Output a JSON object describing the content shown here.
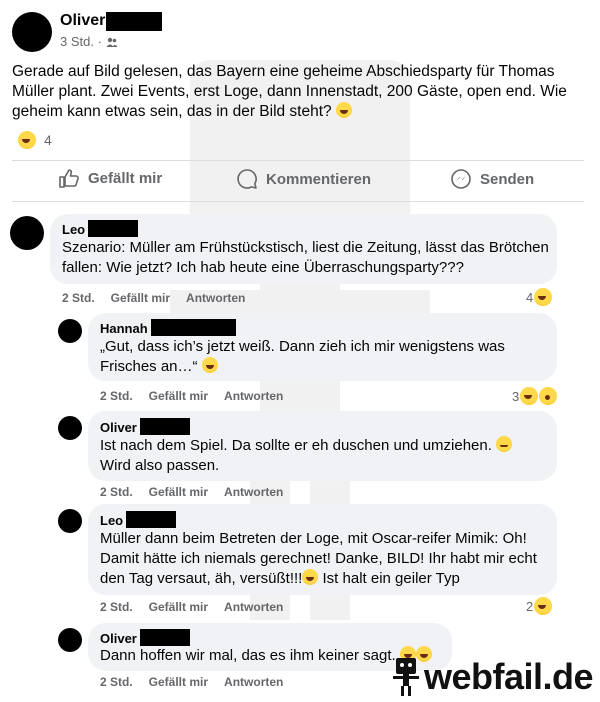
{
  "post": {
    "author": "Oliver",
    "time": "3 Std. ·",
    "audience_icon": "friends-icon",
    "text": "Gerade auf Bild gelesen, das Bayern eine geheime Abschiedsparty für Thomas Müller plant. Zwei Events, erst Loge, dann Innenstadt, 200 Gäste, open end. Wie geheim kann etwas sein, das in der Bild steht?",
    "reaction_count": "4"
  },
  "actions": {
    "like": "Gefällt mir",
    "comment": "Kommentieren",
    "share": "Senden"
  },
  "comments": [
    {
      "name": "Leo",
      "text": "Szenario: Müller am Frühstückstisch, liest die Zeitung, lässt das Brötchen fallen: Wie jetzt? Ich hab heute eine Überraschungsparty???",
      "time": "2 Std.",
      "like": "Gefällt mir",
      "reply": "Antworten",
      "reactions": "4"
    },
    {
      "name": "Hannah",
      "text": "„Gut, dass ich’s jetzt weiß. Dann zieh ich mir wenigstens was Frisches an…“",
      "time": "2 Std.",
      "like": "Gefällt mir",
      "reply": "Antworten",
      "reactions": "3"
    },
    {
      "name": "Oliver",
      "text": "Ist nach dem Spiel. Da sollte er eh duschen und umziehen.",
      "text2": "Wird also passen.",
      "time": "2 Std.",
      "like": "Gefällt mir",
      "reply": "Antworten"
    },
    {
      "name": "Leo",
      "text": "Müller dann beim Betreten der Loge, mit Oscar-reifer Mimik: Oh! Damit hätte ich niemals gerechnet! Danke, BILD! Ihr habt mir echt den Tag versaut, äh, versüßt!!!",
      "text_tail": "Ist halt ein geiler Typ",
      "time": "2 Std.",
      "like": "Gefällt mir",
      "reply": "Antworten",
      "reactions": "2"
    },
    {
      "name": "Oliver",
      "text": "Dann hoffen wir mal, das es ihm keiner sagt.",
      "time": "2 Std.",
      "like": "Gefällt mir",
      "reply": "Antworten"
    }
  ],
  "brand": {
    "text": "webfail.de"
  },
  "colors": {
    "bubble": "#f0f2f5",
    "secondary": "#65676b",
    "divider": "#dadde1",
    "emoji": "#ffd94a"
  }
}
